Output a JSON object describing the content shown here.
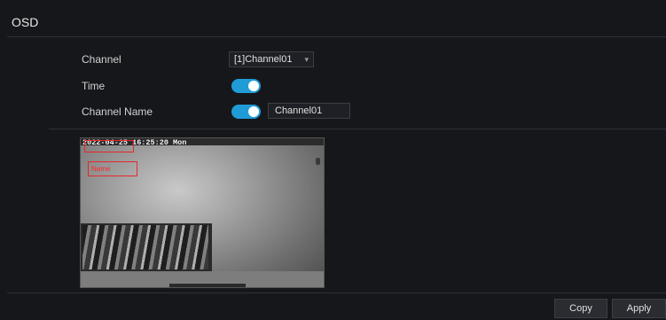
{
  "header": {
    "title": "OSD"
  },
  "form": {
    "channel": {
      "label": "Channel",
      "value": "[1]Channel01"
    },
    "time": {
      "label": "Time",
      "enabled": true
    },
    "channel_name": {
      "label": "Channel Name",
      "enabled": true,
      "value": "Channel01"
    }
  },
  "preview": {
    "timestamp": "2022-04-25 16:25:20 Mon",
    "name_overlay": "Name"
  },
  "footer": {
    "copy_label": "Copy",
    "apply_label": "Apply"
  },
  "colors": {
    "toggle_on": "#1f9cd6",
    "overlay_border": "#e8272b",
    "background": "#16171b"
  },
  "icons": {
    "dropdown": "chevron-down-icon"
  }
}
